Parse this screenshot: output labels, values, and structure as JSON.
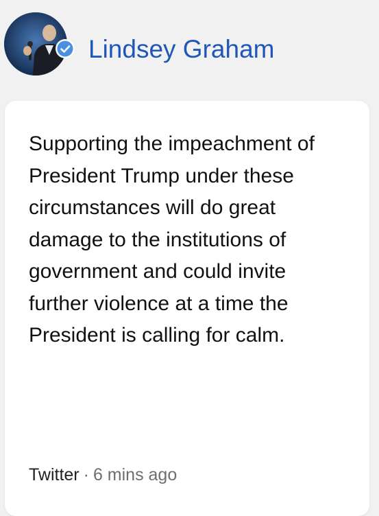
{
  "author": {
    "name": "Lindsey Graham",
    "verified": true,
    "avatar_icon": "profile-photo",
    "verified_icon": "verified-badge-icon",
    "name_color": "#1f57b9",
    "badge_color": "#4a8fe0"
  },
  "post": {
    "lines": [
      "Supporting the impeachment of",
      "President Trump under these",
      "circumstances will do great",
      "damage to the institutions of",
      "government and could invite",
      "further violence at a time the",
      "President is calling for calm."
    ]
  },
  "footer": {
    "source": "Twitter",
    "separator": "·",
    "time": "6 mins ago"
  }
}
